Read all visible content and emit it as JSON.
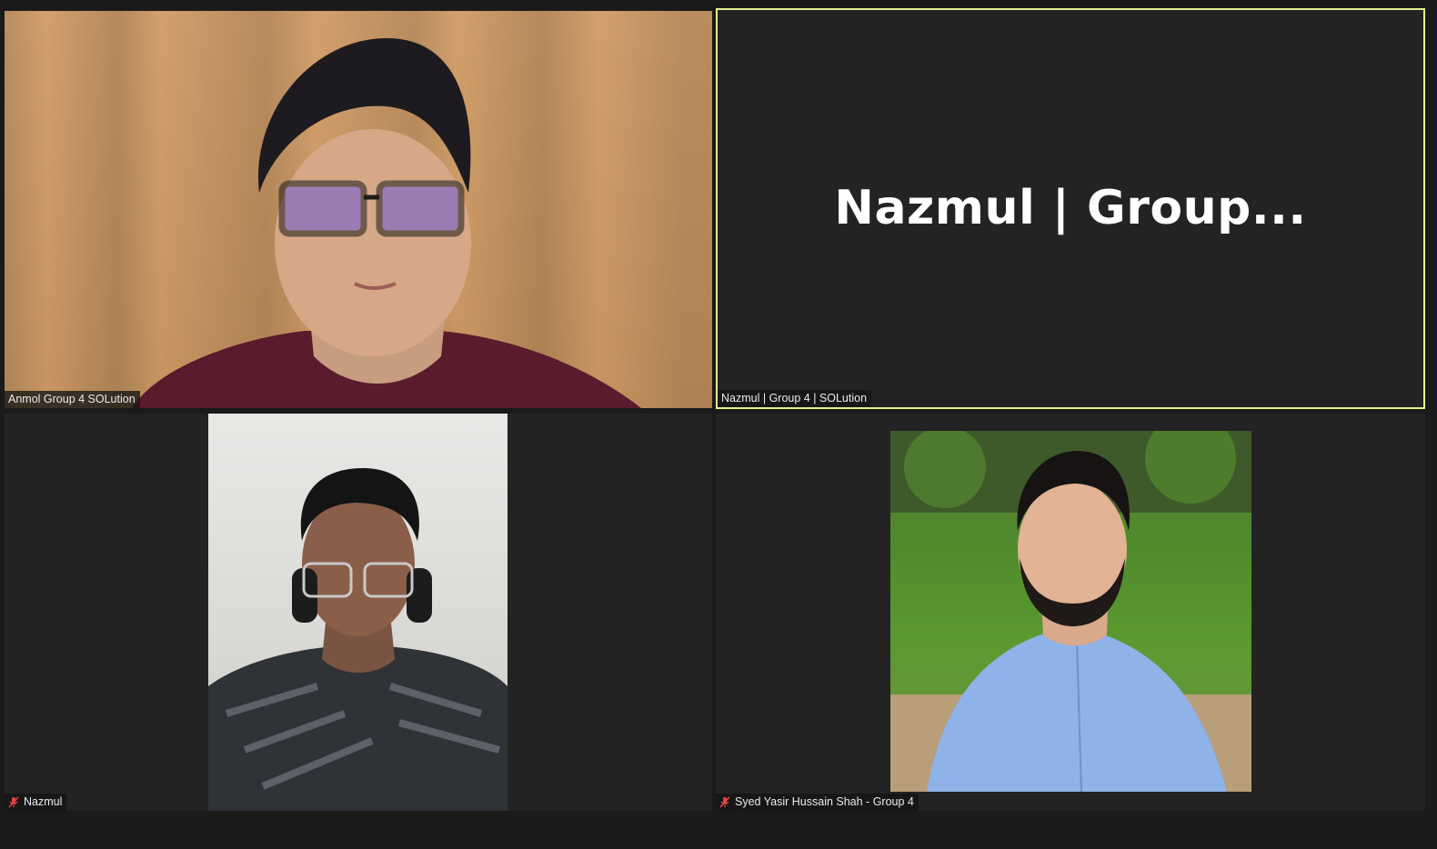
{
  "participants": [
    {
      "name": "Anmol Group 4 SOLution",
      "muted": false,
      "video": "on"
    },
    {
      "name": "Nazmul | Group 4 | SOLution",
      "display_name_large": "Nazmul | Group...",
      "muted": false,
      "video": "off",
      "active_speaker": true
    },
    {
      "name": "Nazmul",
      "muted": true,
      "video": "on"
    },
    {
      "name": "Syed Yasir Hussain Shah - Group 4",
      "muted": true,
      "video": "on"
    }
  ],
  "icons": {
    "muted_mic": "mic-muted-icon"
  },
  "colors": {
    "active_speaker_border": "#e6f08c",
    "muted_icon": "#e0453b",
    "tile_bg": "#232323"
  }
}
